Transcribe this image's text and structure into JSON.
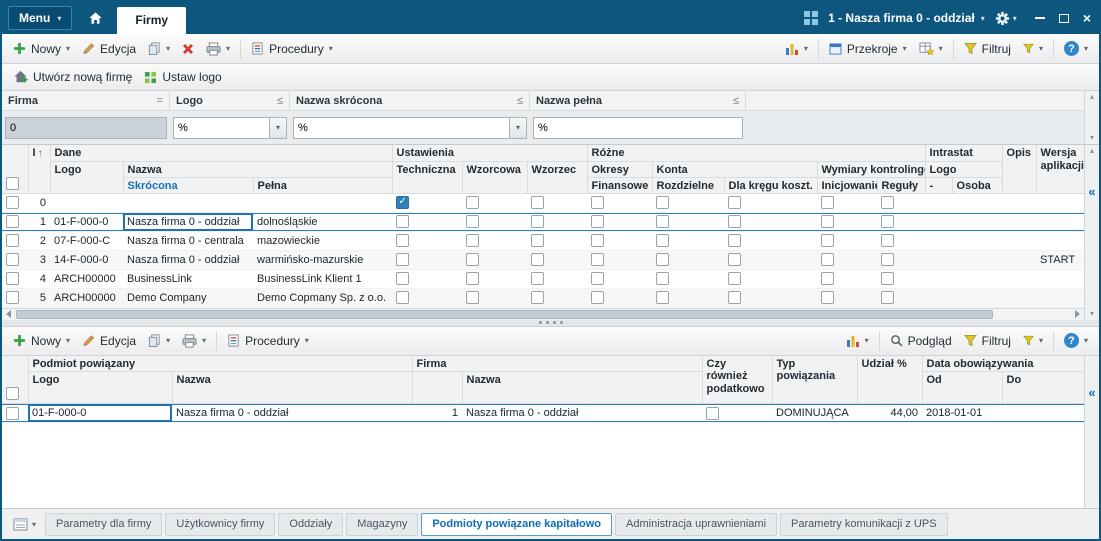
{
  "icons": {
    "dropdown": "▾",
    "sort_asc": "↑",
    "collapse_left": "«",
    "scroll_up": "▴",
    "scroll_down": "▾",
    "close": "×",
    "help": "?"
  },
  "titlebar": {
    "menu_label": "Menu",
    "active_tab": "Firmy",
    "company_selector": "1 - Nasza firma 0 - oddział"
  },
  "toolbar_main": {
    "nowy": "Nowy",
    "edycja": "Edycja",
    "procedury": "Procedury",
    "przekroje": "Przekroje",
    "filtruj": "Filtruj"
  },
  "toolbar_links": {
    "utworz": "Utwórz nową firmę",
    "ustaw_logo": "Ustaw logo"
  },
  "filter_panel": {
    "fields": [
      {
        "label": "Firma",
        "op": "=",
        "value": "0"
      },
      {
        "label": "Logo",
        "op": "≤",
        "value": "%"
      },
      {
        "label": "Nazwa skrócona",
        "op": "≤",
        "value": "%"
      },
      {
        "label": "Nazwa pełna",
        "op": "≤",
        "value": "%"
      }
    ]
  },
  "grid_main": {
    "selected_row_index": 1,
    "headers": {
      "i": "I",
      "dane": "Dane",
      "logo": "Logo",
      "nazwa": "Nazwa",
      "skrocona": "Skrócona",
      "pelna": "Pełna",
      "ustawienia": "Ustawienia",
      "techniczna": "Techniczna",
      "wzorcowa": "Wzorcowa",
      "wzorzec": "Wzorzec",
      "rozne": "Różne",
      "okresy": "Okresy",
      "finansowe": "Finansowe",
      "konta": "Konta",
      "rozdzielne": "Rozdzielne",
      "dla_kregu": "Dla kręgu koszt.",
      "wymiary": "Wymiary kontrolingowe",
      "inicjowanie": "Inicjowanie",
      "reguly": "Reguły",
      "intrastat": "Intrastat",
      "intrastat_logo": "Logo",
      "dash": "-",
      "osoba": "Osoba",
      "opis": "Opis",
      "wersja": "Wersja aplikacji"
    },
    "rows": [
      {
        "i": "0",
        "logo": "",
        "skrocona": "",
        "pelna": "",
        "wersja": "",
        "checks": {
          "techniczna": true,
          "wzorcowa": false,
          "wzorzec": false,
          "finansowe": false,
          "rozdzielne": false,
          "dla_kregu": false,
          "inicjowanie": false,
          "reguly": false
        }
      },
      {
        "i": "1",
        "logo": "01-F-000-0",
        "skrocona": "Nasza firma 0 - oddział",
        "pelna": "dolnośląskie",
        "wersja": "",
        "checks": {
          "techniczna": false,
          "wzorcowa": false,
          "wzorzec": false,
          "finansowe": false,
          "rozdzielne": false,
          "dla_kregu": false,
          "inicjowanie": false,
          "reguly": false
        }
      },
      {
        "i": "2",
        "logo": "07-F-000-C",
        "skrocona": "Nasza firma 0 - centrala",
        "pelna": "mazowieckie",
        "wersja": "",
        "checks": {
          "techniczna": false,
          "wzorcowa": false,
          "wzorzec": false,
          "finansowe": false,
          "rozdzielne": false,
          "dla_kregu": false,
          "inicjowanie": false,
          "reguly": false
        }
      },
      {
        "i": "3",
        "logo": "14-F-000-0",
        "skrocona": "Nasza firma 0 - oddział",
        "pelna": "warmińsko-mazurskie",
        "wersja": "START",
        "checks": {
          "techniczna": false,
          "wzorcowa": false,
          "wzorzec": false,
          "finansowe": false,
          "rozdzielne": false,
          "dla_kregu": false,
          "inicjowanie": false,
          "reguly": false
        }
      },
      {
        "i": "4",
        "logo": "ARCH00000",
        "skrocona": "BusinessLink",
        "pelna": "BusinessLink Klient 1",
        "wersja": "",
        "checks": {
          "techniczna": false,
          "wzorcowa": false,
          "wzorzec": false,
          "finansowe": false,
          "rozdzielne": false,
          "dla_kregu": false,
          "inicjowanie": false,
          "reguly": false
        }
      },
      {
        "i": "5",
        "logo": "ARCH00000",
        "skrocona": "Demo Company",
        "pelna": "Demo Copmany Sp. z o.o.",
        "wersja": "",
        "checks": {
          "techniczna": false,
          "wzorcowa": false,
          "wzorzec": false,
          "finansowe": false,
          "rozdzielne": false,
          "dla_kregu": false,
          "inicjowanie": false,
          "reguly": false
        }
      }
    ]
  },
  "toolbar_related": {
    "nowy": "Nowy",
    "edycja": "Edycja",
    "procedury": "Procedury",
    "podglad": "Podgląd",
    "filtruj": "Filtruj"
  },
  "grid_related": {
    "selected_row_index": 0,
    "headers": {
      "podmiot_powiazany": "Podmiot powiązany",
      "logo": "Logo",
      "nazwa": "Nazwa",
      "firma": "Firma",
      "firma_nazwa": "Nazwa",
      "czy_rowniez": "Czy również podatkowo",
      "typ": "Typ powiązania",
      "udzial": "Udział %",
      "data_obow": "Data obowiązywania",
      "od": "Od",
      "do": "Do"
    },
    "rows": [
      {
        "logo": "01-F-000-0",
        "nazwa": "Nasza firma 0 - oddział",
        "firma_nr": "1",
        "firma_nazwa": "Nasza firma 0 - oddział",
        "czy_podatkowo": false,
        "typ": "DOMINUJĄCA",
        "udzial": "44,00",
        "od": "2018-01-01",
        "do": ""
      }
    ]
  },
  "bottom_tabs": {
    "tabs": [
      {
        "label": "Parametry dla firmy"
      },
      {
        "label": "Użytkownicy firmy"
      },
      {
        "label": "Oddziały"
      },
      {
        "label": "Magazyny"
      },
      {
        "label": "Podmioty powiązane kapitałowo",
        "active": true
      },
      {
        "label": "Administracja uprawnieniami"
      },
      {
        "label": "Parametry komunikacji z UPS"
      }
    ]
  }
}
